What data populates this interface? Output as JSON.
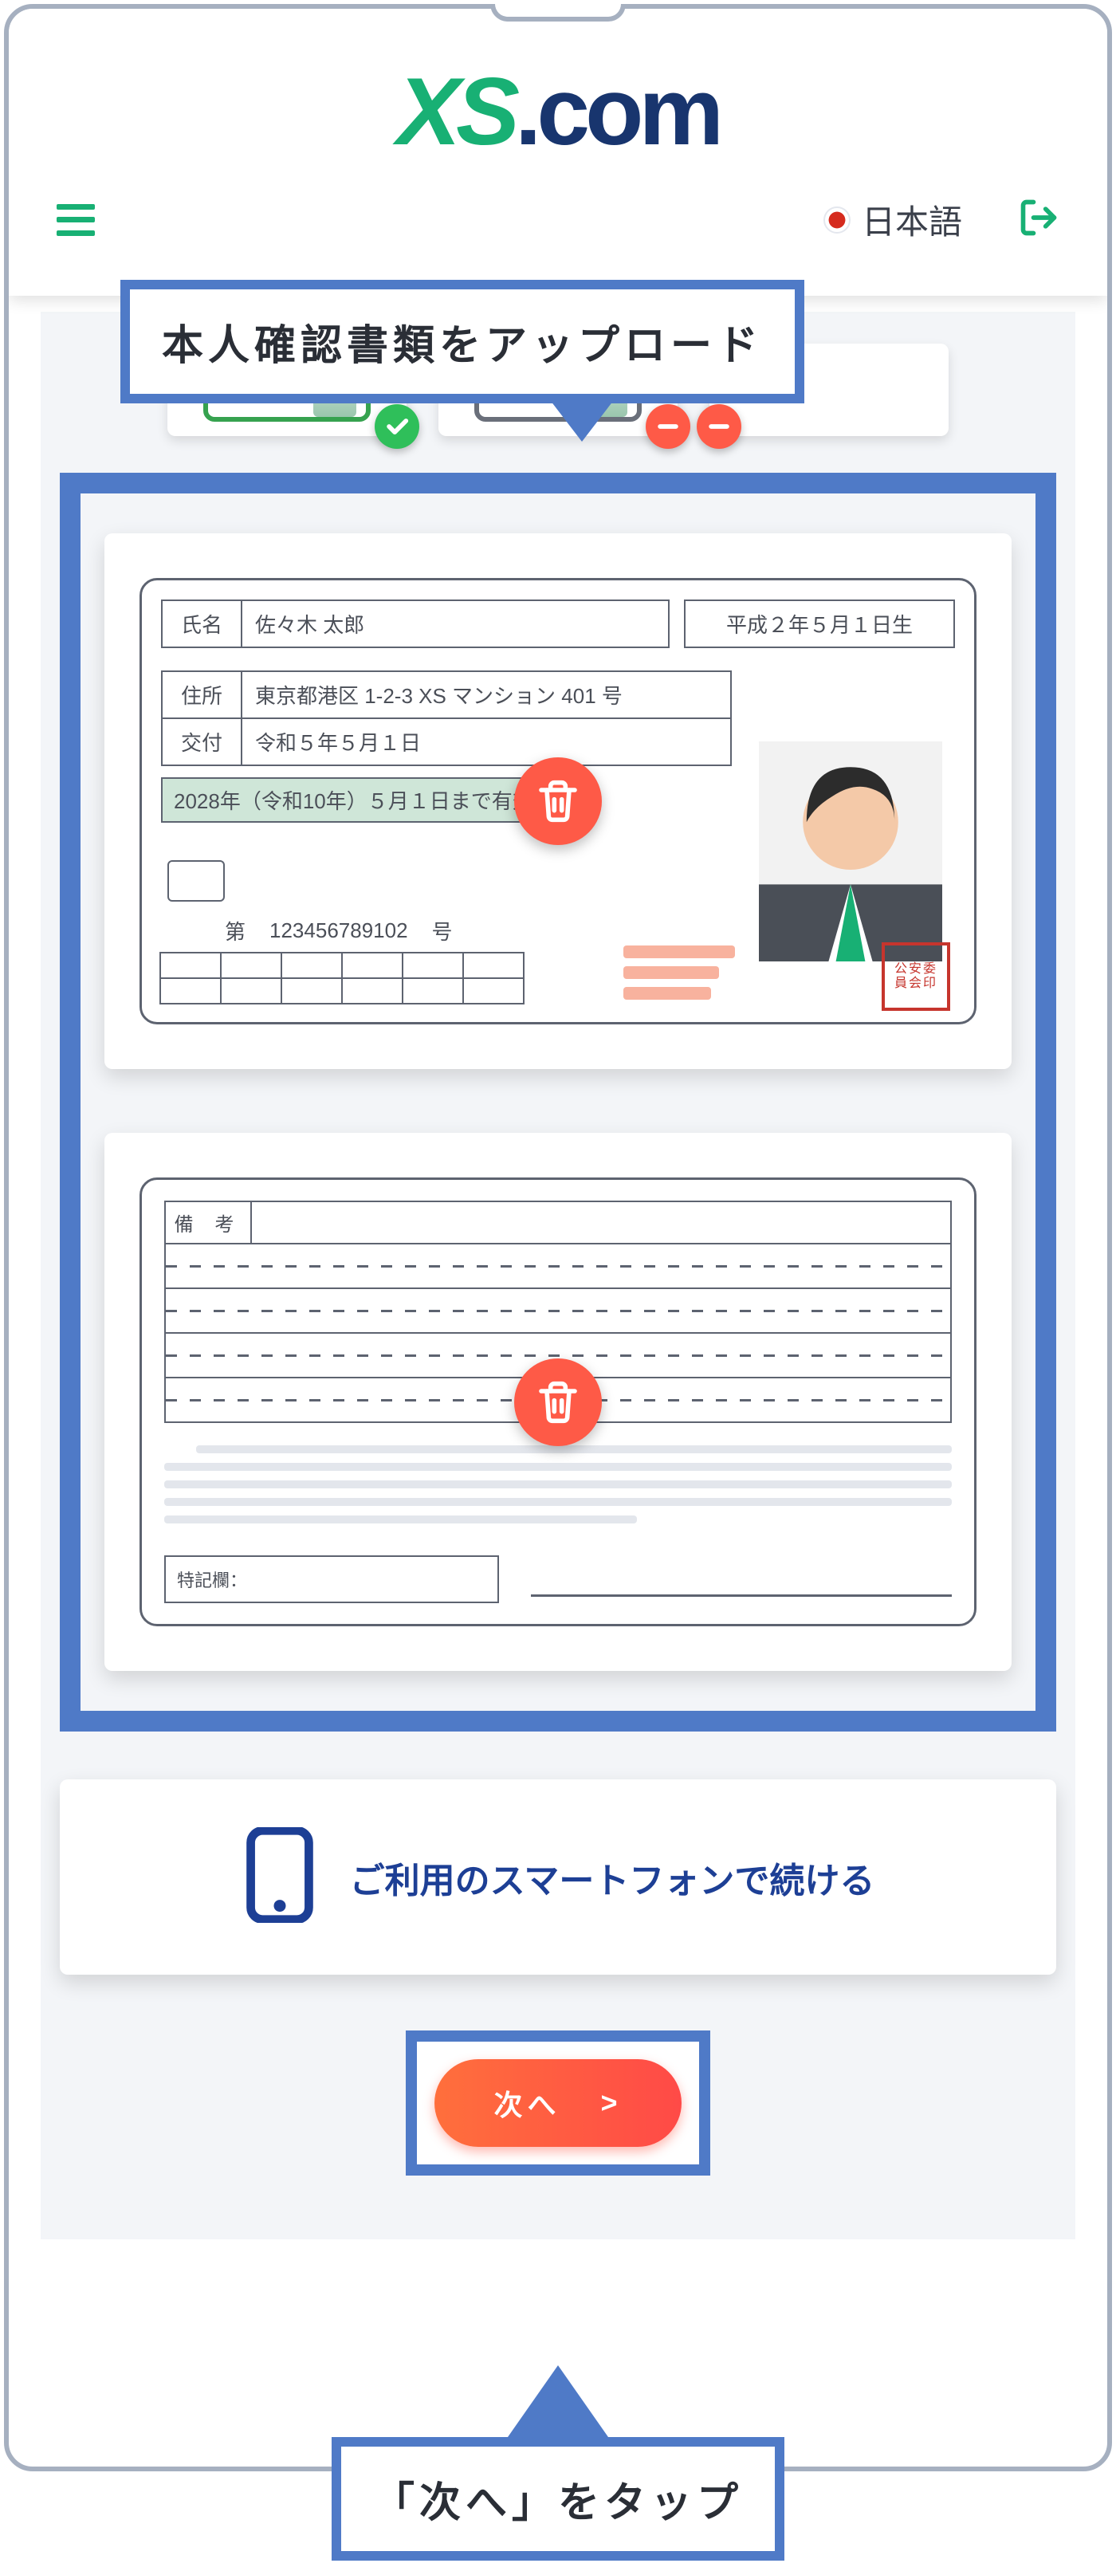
{
  "brand": {
    "xs": "XS",
    "dotcom": ".com"
  },
  "nav": {
    "language": "日本語"
  },
  "callouts": {
    "upload": "本人確認書類をアップロード",
    "tap_next": "「次へ」をタップ"
  },
  "upload": {
    "delete_label": "削除"
  },
  "id_front": {
    "name_label": "氏名",
    "name": "佐々木  太郎",
    "dob": "平成２年５月１日生",
    "addr_label": "住所",
    "addr": "東京都港区 1-2-3 XS マンション 401 号",
    "issued_label": "交付",
    "issued": "令和５年５月１日",
    "validity": "2028年（令和10年）５月１日まで有効",
    "no_prefix": "第",
    "license_no": "123456789102",
    "no_suffix": "号",
    "seal": "公安委員会印"
  },
  "id_back": {
    "remarks_label": "備  考",
    "special_label": "特記欄："
  },
  "continue_phone": "ご利用のスマートフォンで続ける",
  "next_label": "次へ",
  "next_arrow": ">"
}
